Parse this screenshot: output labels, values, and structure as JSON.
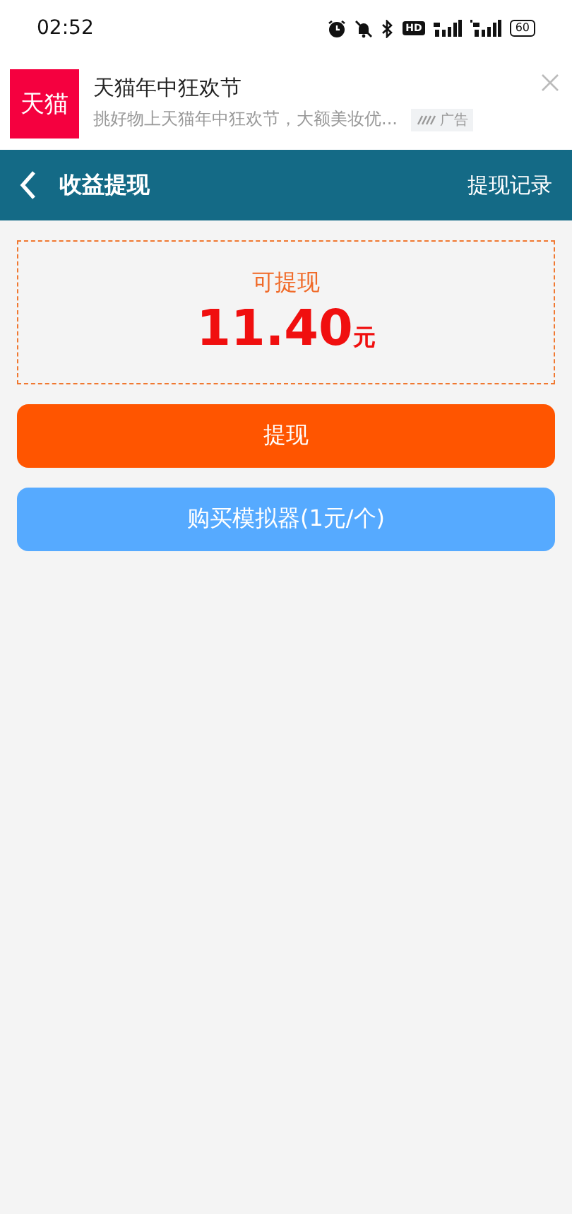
{
  "status_bar": {
    "time": "02:52",
    "hd_badge": "HD",
    "battery": "60"
  },
  "ad": {
    "logo": "天猫",
    "title": "天猫年中狂欢节",
    "description": "挑好物上天猫年中狂欢节，大额美妆优...",
    "tag": "广告"
  },
  "header": {
    "title": "收益提现",
    "action": "提现记录"
  },
  "balance": {
    "label": "可提现",
    "amount": "11.40",
    "unit": "元"
  },
  "buttons": [
    {
      "label": "提现",
      "kind": "primary"
    },
    {
      "label": "购买模拟器(1元/个)",
      "kind": "secondary"
    }
  ]
}
